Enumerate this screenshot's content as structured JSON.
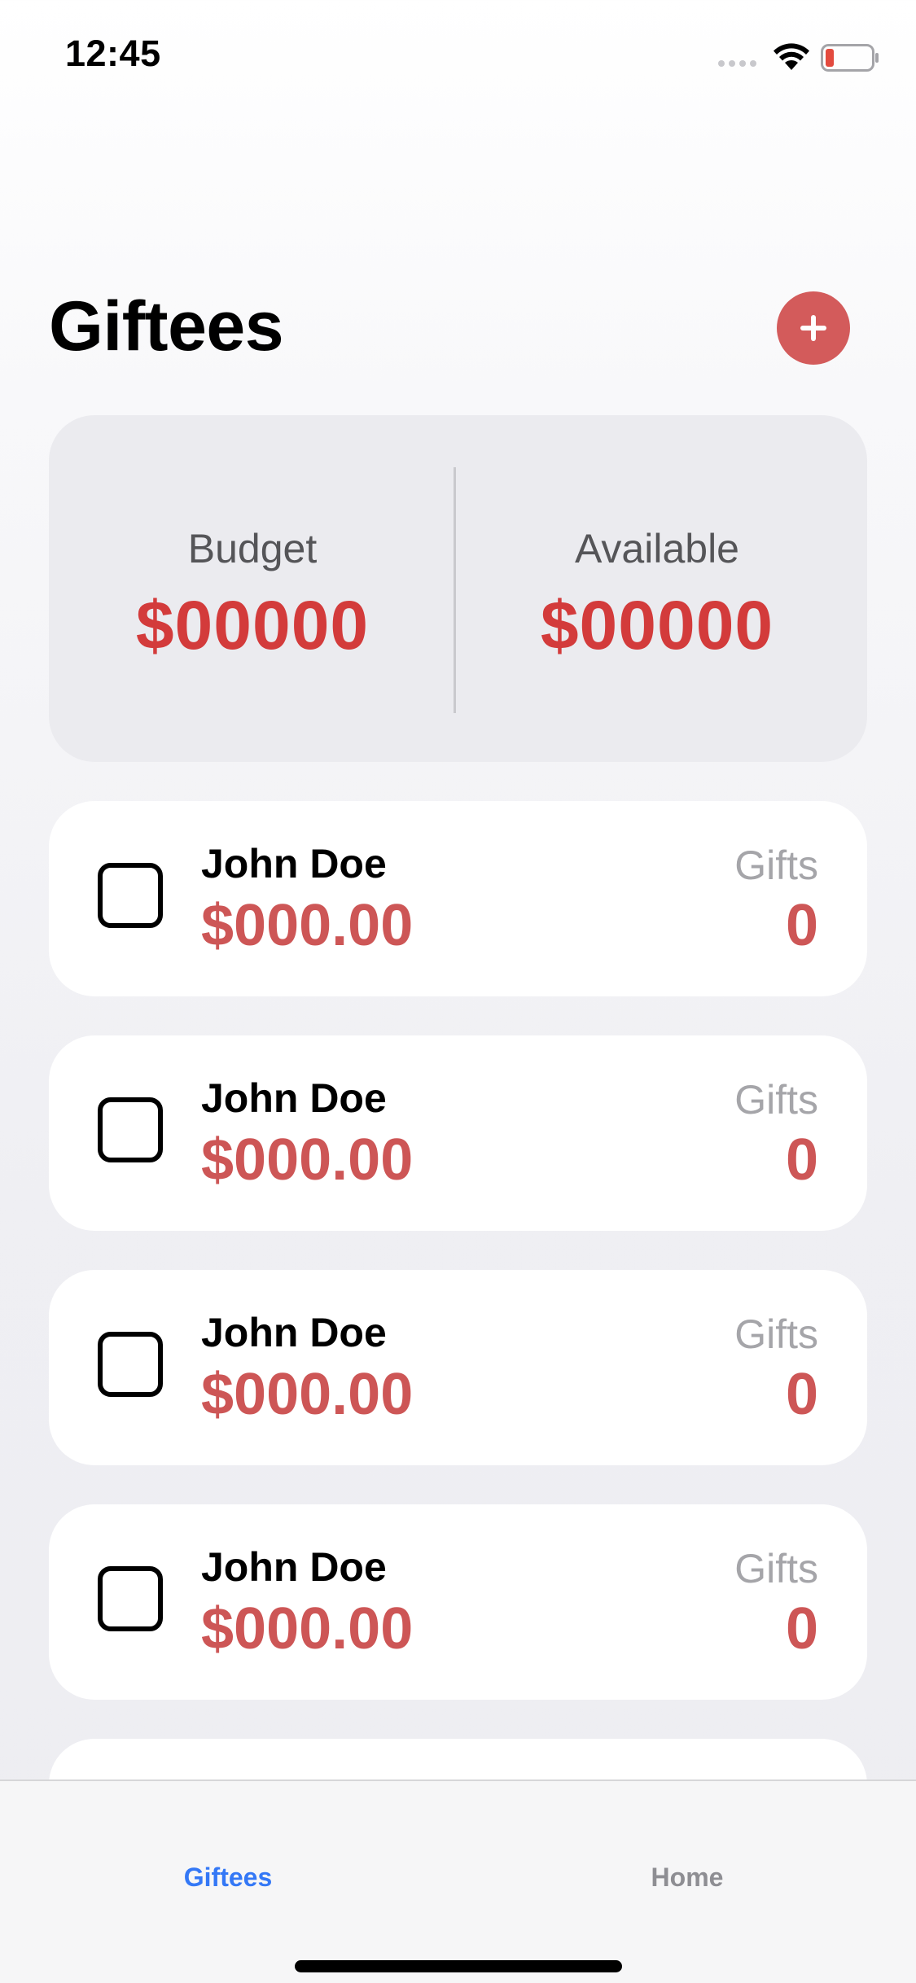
{
  "status_bar": {
    "time": "12:45",
    "icons": [
      "signal-icon",
      "wifi-icon",
      "battery-icon"
    ],
    "battery_color": "#e34a3e"
  },
  "header": {
    "title": "Giftees",
    "add_icon": "plus-icon",
    "accent_color": "#d35b5b"
  },
  "summary": {
    "budget_label": "Budget",
    "budget_value": "$00000",
    "available_label": "Available",
    "available_value": "$00000",
    "value_color": "#d33b3b"
  },
  "giftees": [
    {
      "name": "John Doe",
      "amount": "$000.00",
      "gifts_label": "Gifts",
      "gifts_count": "0",
      "checked": false
    },
    {
      "name": "John Doe",
      "amount": "$000.00",
      "gifts_label": "Gifts",
      "gifts_count": "0",
      "checked": false
    },
    {
      "name": "John Doe",
      "amount": "$000.00",
      "gifts_label": "Gifts",
      "gifts_count": "0",
      "checked": false
    },
    {
      "name": "John Doe",
      "amount": "$000.00",
      "gifts_label": "Gifts",
      "gifts_count": "0",
      "checked": false
    }
  ],
  "tab_bar": {
    "tabs": [
      {
        "label": "Giftees",
        "active": true
      },
      {
        "label": "Home",
        "active": false
      }
    ],
    "active_color": "#3478f6",
    "inactive_color": "#8e8e93"
  }
}
